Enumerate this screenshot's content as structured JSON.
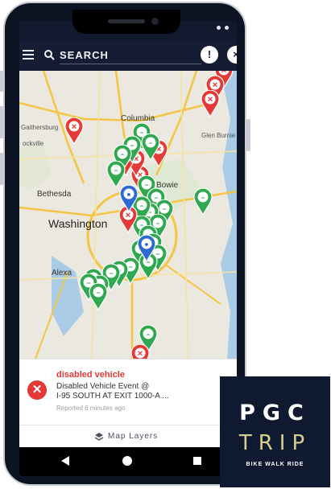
{
  "search": {
    "placeholder": "SEARCH"
  },
  "appbar": {
    "info_label": "!",
    "close_label": "×"
  },
  "map": {
    "places": [
      "Columbia",
      "Glen Burnie",
      "Bethesda",
      "Washington",
      "Bowie",
      "Alexa",
      "Gaithersburg",
      "ockville",
      "Bow"
    ]
  },
  "pins": [
    {
      "kind": "disabled-vehicle",
      "color": "#e53935",
      "glyph": "✕"
    },
    {
      "kind": "event",
      "color": "#2fa84f",
      "glyph": "–"
    },
    {
      "kind": "road-work",
      "color": "#2d6bd0",
      "glyph": "●"
    }
  ],
  "alert": {
    "title": "disabled vehicle",
    "line1": "Disabled Vehicle Event @",
    "line2": "I-95 SOUTH AT EXIT 1000-A ...",
    "time": "Reported 6 minutes ago",
    "icon_label": "✕",
    "accent": "#e53935"
  },
  "layers": {
    "label": "Map Layers"
  },
  "brand": {
    "line1": "PGC",
    "line2": "TRIP",
    "tagline": "BIKE WALK RIDE",
    "accent": "#d8cf8e"
  }
}
